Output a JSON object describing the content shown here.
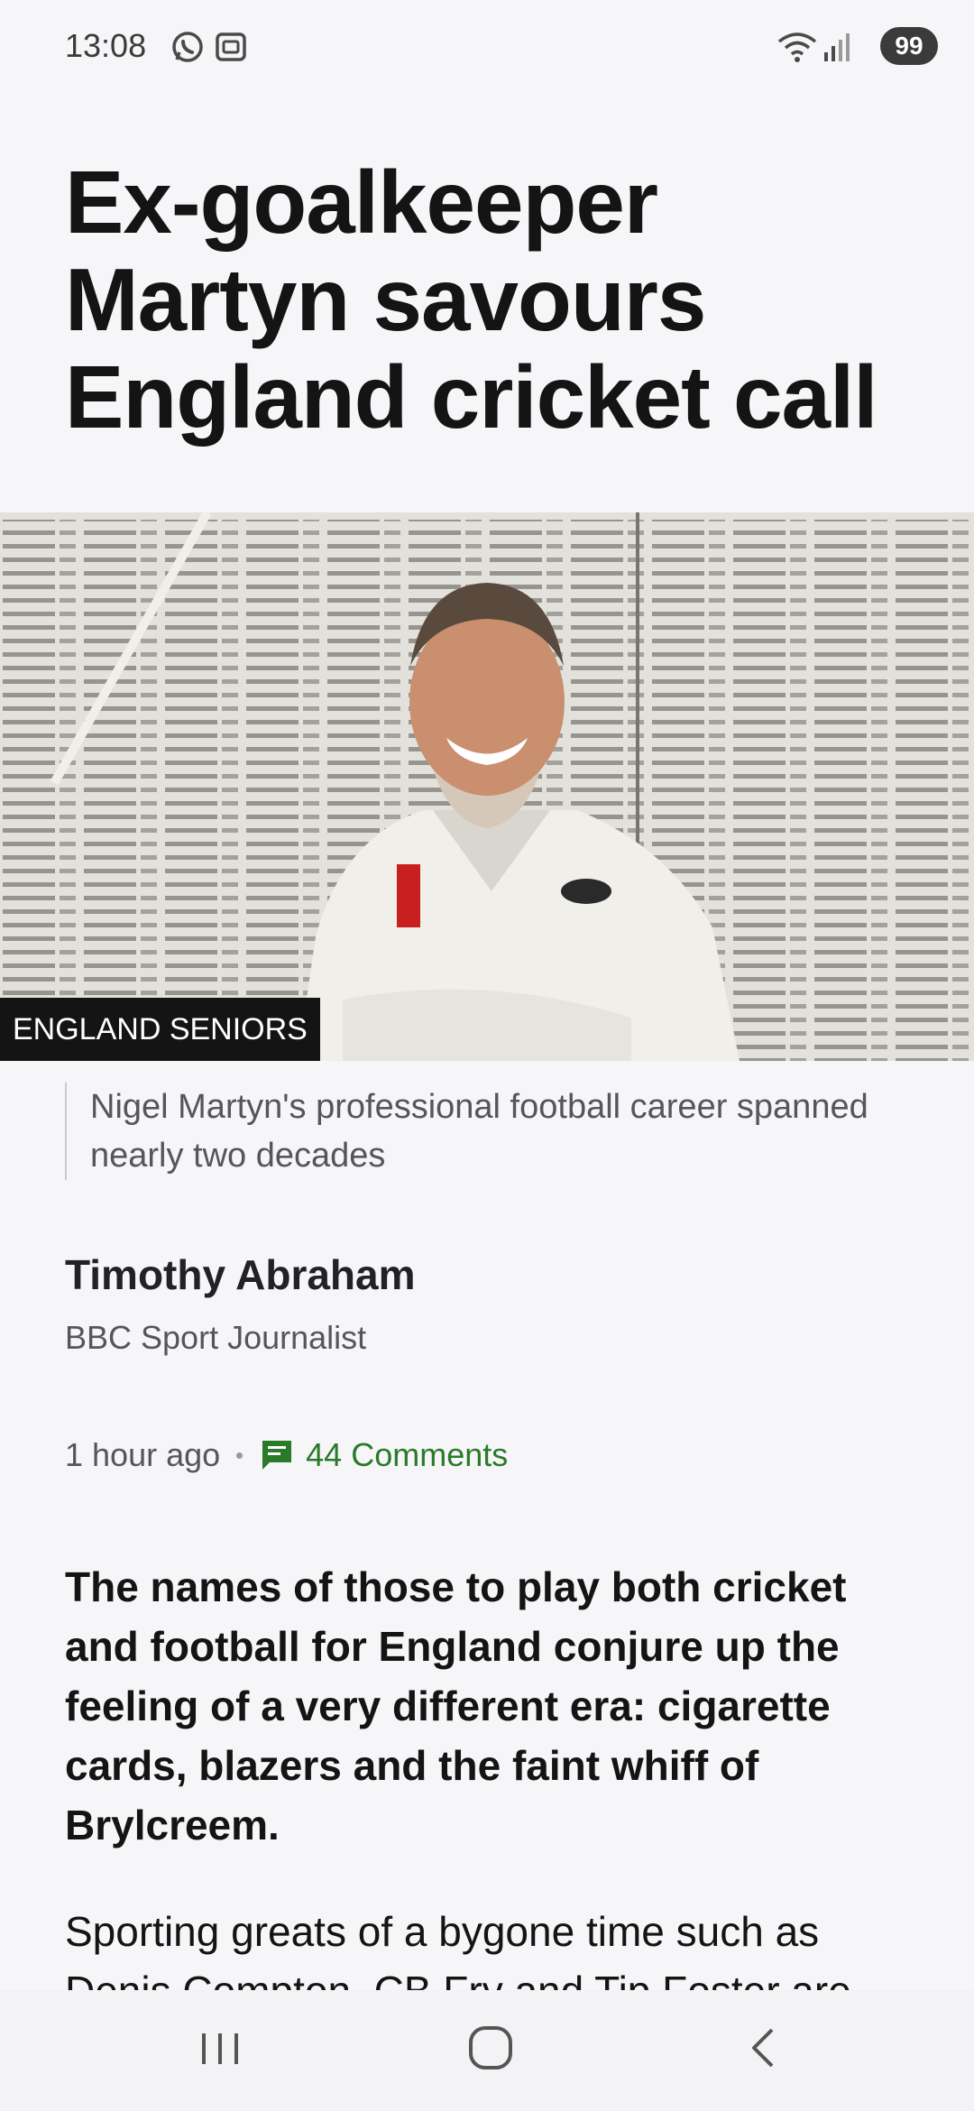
{
  "status_bar": {
    "time": "13:08",
    "battery": "99",
    "icons": [
      "whatsapp-icon",
      "screenshot-icon",
      "wifi-icon",
      "signal-icon",
      "battery-icon"
    ]
  },
  "article": {
    "headline": "Ex-goalkeeper Martyn savours England cricket call",
    "image_tag": "ENGLAND SENIORS",
    "caption": "Nigel Martyn's professional football career spanned nearly two decades",
    "author_name": "Timothy Abraham",
    "author_role": "BBC Sport Journalist",
    "time_ago": "1 hour ago",
    "comments": "44 Comments",
    "lead": "The names of those to play both cricket and football for England conjure up the feeling of a very different era: cigarette cards, blazers and the faint whiff of Brylcreem.",
    "body": "Sporting greats of a bygone time such as Denis Compton, CB Fry and Tip Foster are"
  },
  "colors": {
    "background": "#f6f6f8",
    "comments_green": "#2a7a2a",
    "tag_bg": "#141414"
  },
  "nav_bar": {
    "buttons": [
      "recent-apps-icon",
      "home-icon",
      "back-icon"
    ]
  }
}
